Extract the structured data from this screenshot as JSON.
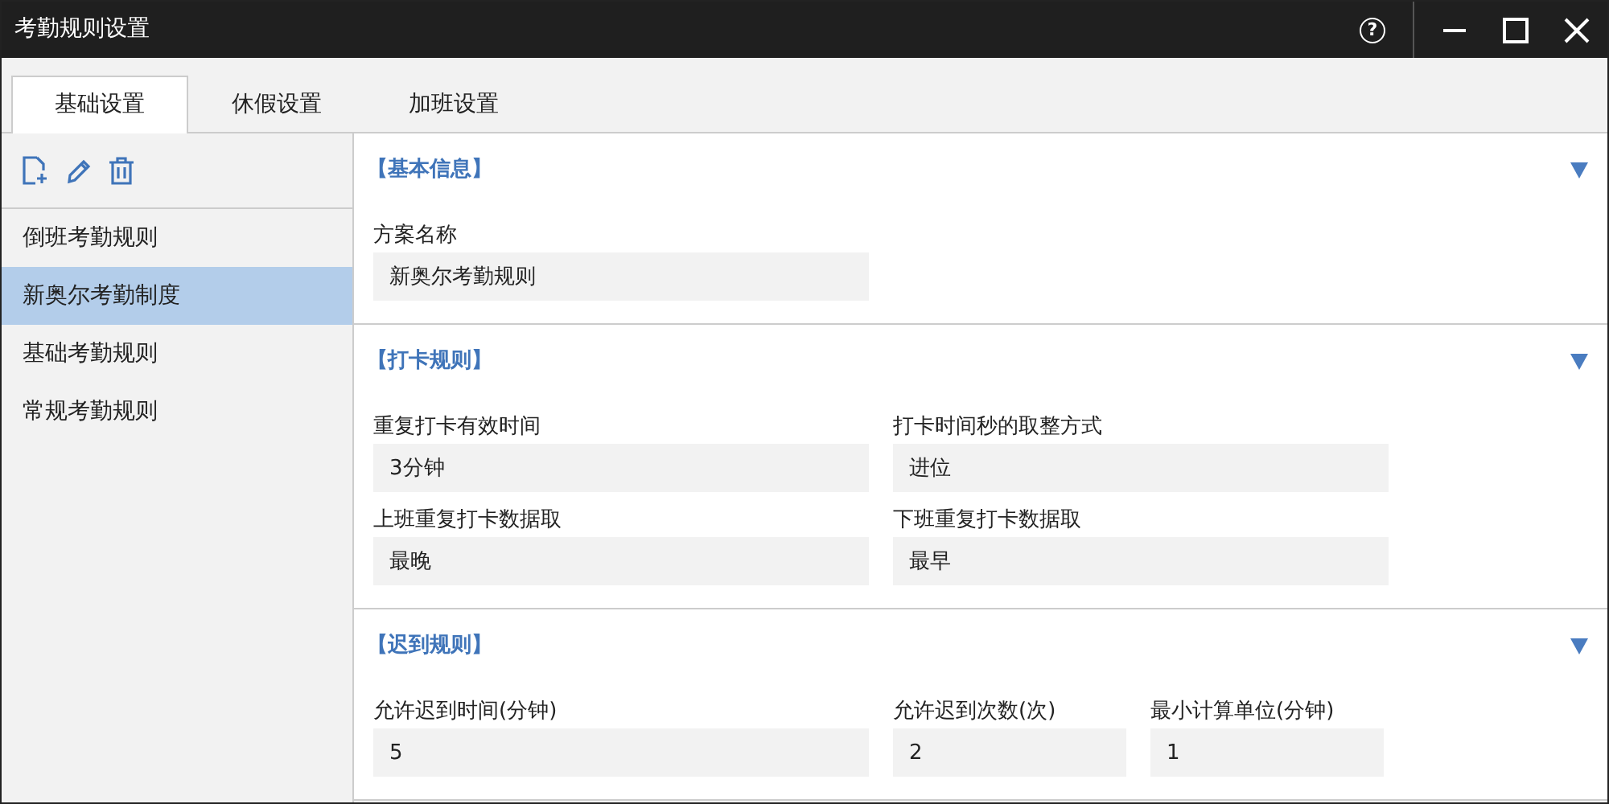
{
  "window": {
    "title": "考勤规则设置",
    "help": "?"
  },
  "tabs": [
    {
      "label": "基础设置",
      "selected": true
    },
    {
      "label": "休假设置",
      "selected": false
    },
    {
      "label": "加班设置",
      "selected": false
    }
  ],
  "sidebar": {
    "items": [
      {
        "label": "倒班考勤规则",
        "selected": false
      },
      {
        "label": "新奥尔考勤制度",
        "selected": true
      },
      {
        "label": "基础考勤规则",
        "selected": false
      },
      {
        "label": "常规考勤规则",
        "selected": false
      }
    ]
  },
  "sections": [
    {
      "title": "【基本信息】",
      "expanded": true,
      "rows": [
        [
          {
            "label": "方案名称",
            "value": "新奥尔考勤规则",
            "kind": "wide"
          }
        ]
      ]
    },
    {
      "title": "【打卡规则】",
      "expanded": true,
      "rows": [
        [
          {
            "label": "重复打卡有效时间",
            "value": "3分钟",
            "kind": "wide"
          },
          {
            "label": "打卡时间秒的取整方式",
            "value": "进位",
            "kind": "wide"
          }
        ],
        [
          {
            "label": "上班重复打卡数据取",
            "value": "最晚",
            "kind": "wide"
          },
          {
            "label": "下班重复打卡数据取",
            "value": "最早",
            "kind": "wide"
          }
        ]
      ]
    },
    {
      "title": "【迟到规则】",
      "expanded": true,
      "rows": [
        [
          {
            "label": "允许迟到时间(分钟)",
            "value": "5",
            "kind": "wide"
          },
          {
            "label": "允许迟到次数(次)",
            "value": "2",
            "kind": "narrow"
          },
          {
            "label": "最小计算单位(分钟)",
            "value": "1",
            "kind": "narrow"
          }
        ]
      ]
    }
  ]
}
